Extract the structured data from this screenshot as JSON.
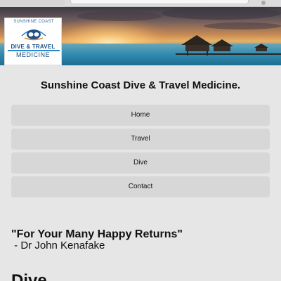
{
  "logo": {
    "arc_text": "SUNSHINE COAST",
    "line1": "DIVE & TRAVEL",
    "line2": "MEDICINE"
  },
  "header": {
    "title": "Sunshine Coast Dive & Travel Medicine."
  },
  "nav": {
    "items": [
      {
        "label": "Home"
      },
      {
        "label": "Travel"
      },
      {
        "label": "Dive"
      },
      {
        "label": "Contact"
      }
    ]
  },
  "quote": {
    "text": "\"For Your Many Happy Returns\"",
    "author": " - Dr John Kenafake"
  },
  "section": {
    "heading": "Dive"
  },
  "colors": {
    "background": "#e6e6e6",
    "nav_button": "#d7d7d7",
    "logo_blue": "#1b4f86"
  },
  "icons": [
    "diver-mask-icon"
  ]
}
